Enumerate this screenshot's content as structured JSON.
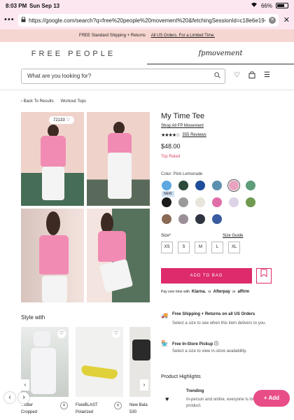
{
  "status": {
    "time": "8:03 PM",
    "date": "Sun Sep 13",
    "battery": "66%"
  },
  "browser": {
    "url": "https://google.com/search?q=free%20people%20movement%20&fetchingSessionId=c18e6e19-..."
  },
  "promo": {
    "text": "FREE Standard Shipping + Returns",
    "link": "All US Orders. For a Limited Time."
  },
  "brands": {
    "left": "FREE PEOPLE",
    "right": "fpmovement"
  },
  "search": {
    "placeholder": "What are you looking for?"
  },
  "breadcrumb": {
    "back": "Back To Results",
    "category": "Workout Tops"
  },
  "gallery": {
    "likes": "72133"
  },
  "product": {
    "title": "My Time Tee",
    "collection": "Shop All FP Movement",
    "reviews": "355 Reviews",
    "price": "$48.00",
    "badge": "Top Rated",
    "rating": 4,
    "color_label": "Color: Pink Lemonade",
    "new_tag": "NEW",
    "swatches": [
      "#5fa7e0",
      "#2d4a3a",
      "#1f4d9a",
      "#5b8fb0",
      "#e7a3bf",
      "#5f9c7a",
      "#1b1b1b",
      "#9a9a9a",
      "#e9e4dc",
      "#e06ea9",
      "#ddd3e6",
      "#6f9a4f",
      "#8a6a55",
      "#9b8f98",
      "#2e3440",
      "#3a5ba0"
    ],
    "selected_color": "#e7a3bf",
    "size_label": "Size*",
    "size_guide": "Size Guide",
    "sizes": [
      "XS",
      "S",
      "M",
      "L",
      "XL"
    ],
    "add_to_bag": "ADD TO BAG",
    "pay_text": "Pay over time with",
    "pay_options": [
      "Klarna.",
      "Afterpay",
      "affirm"
    ],
    "pay_or": "or"
  },
  "shipping": [
    {
      "title": "Free Shipping + Returns on all US Orders",
      "desc": "Select a size to see when this item delivers to you."
    },
    {
      "title": "Free In-Store Pickup",
      "desc": "Select a size to view in-store availability."
    }
  ],
  "highlights": {
    "title": "Product Highlights",
    "trend_title": "Trending",
    "trend_desc": "In-person and online, everyone is loving this product."
  },
  "fab": {
    "label": "+ Add"
  },
  "style_with": {
    "title": "Style with",
    "items": [
      {
        "name_line1": "...utter",
        "name_line2": "Cropped"
      },
      {
        "name_line1": "FixieBLAST",
        "name_line2": "Polarized"
      },
      {
        "name_line1": "New Bala",
        "name_line2": "530"
      }
    ]
  }
}
